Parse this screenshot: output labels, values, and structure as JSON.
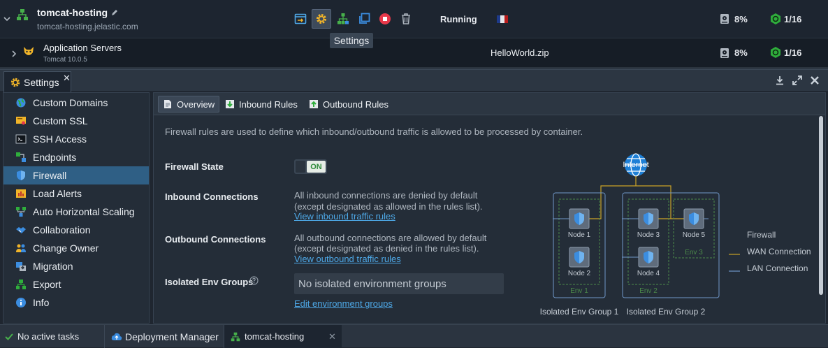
{
  "env": {
    "name": "tomcat-hosting",
    "domain": "tomcat-hosting.jelastic.com",
    "status": "Running",
    "cpu": "8%",
    "cloudlets": "1/16",
    "tooltip": "Settings"
  },
  "node": {
    "name": "Application Servers",
    "version": "Tomcat 10.0.5",
    "deployment": "HelloWorld.zip",
    "cpu": "8%",
    "cloudlets": "1/16"
  },
  "panel": {
    "tab_label": "Settings"
  },
  "sidebar": {
    "items": [
      {
        "label": "Custom Domains",
        "icon": "globe-icon"
      },
      {
        "label": "Custom SSL",
        "icon": "certificate-icon"
      },
      {
        "label": "SSH Access",
        "icon": "terminal-icon"
      },
      {
        "label": "Endpoints",
        "icon": "endpoints-icon"
      },
      {
        "label": "Firewall",
        "icon": "shield-icon"
      },
      {
        "label": "Load Alerts",
        "icon": "alert-icon"
      },
      {
        "label": "Auto Horizontal Scaling",
        "icon": "scaling-icon"
      },
      {
        "label": "Collaboration",
        "icon": "handshake-icon"
      },
      {
        "label": "Change Owner",
        "icon": "users-icon"
      },
      {
        "label": "Migration",
        "icon": "migration-icon"
      },
      {
        "label": "Export",
        "icon": "export-icon"
      },
      {
        "label": "Info",
        "icon": "info-icon"
      }
    ]
  },
  "tabs": [
    "Overview",
    "Inbound Rules",
    "Outbound Rules"
  ],
  "firewall": {
    "intro": "Firewall rules are used to define which inbound/outbound traffic is allowed to be processed by container.",
    "state_label": "Firewall State",
    "state_value": "ON",
    "inbound_label": "Inbound Connections",
    "inbound_desc1": "All inbound connections are denied by default",
    "inbound_desc2": "(except designated as allowed in the rules list).",
    "inbound_link": "View inbound traffic rules",
    "outbound_label": "Outbound Connections",
    "outbound_desc1": "All outbound connections are allowed by default",
    "outbound_desc2": "(except designated as denied in the rules list).",
    "outbound_link": "View outbound traffic rules",
    "groups_label": "Isolated Env Groups",
    "groups_value": "No isolated environment groups",
    "groups_link": "Edit environment groups"
  },
  "diagram": {
    "internet": "Internet",
    "nodes": [
      "Node 1",
      "Node 2",
      "Node 3",
      "Node 4",
      "Node 5"
    ],
    "envs": [
      "Env 1",
      "Env 2",
      "Env 3"
    ],
    "groups": [
      "Isolated Env Group 1",
      "Isolated Env Group 2"
    ],
    "legend": [
      "Firewall",
      "WAN Connection",
      "LAN Connection"
    ],
    "colors": {
      "wan": "#c9a227",
      "lan": "#6f97c8",
      "firewall": "#4c8a4a"
    }
  },
  "bottom": {
    "tasks": "No active tasks",
    "deploy": "Deployment Manager",
    "env_tab": "tomcat-hosting"
  }
}
